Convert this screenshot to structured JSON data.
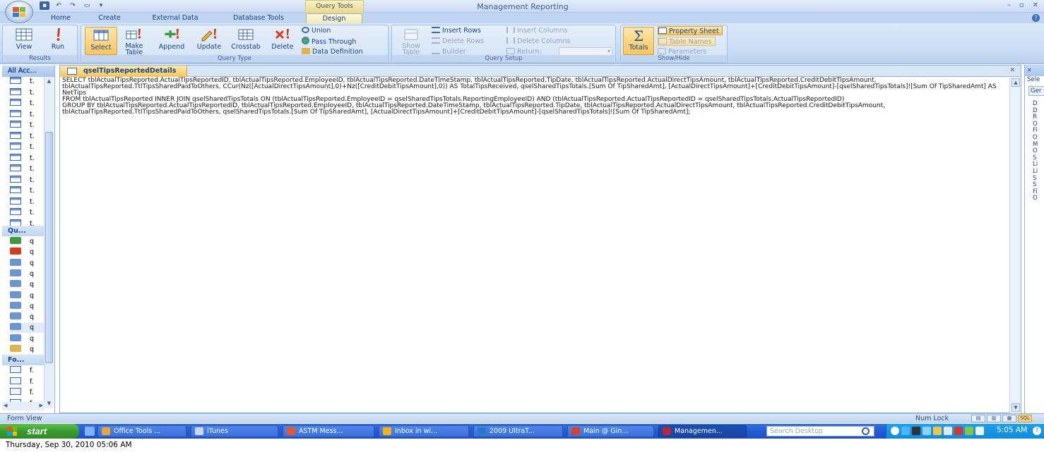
{
  "window": {
    "title": "Management Reporting",
    "contextual_tab_group": "Query Tools",
    "controls": [
      "–",
      "▫",
      "✕"
    ]
  },
  "tabs": [
    {
      "label": "Home"
    },
    {
      "label": "Create"
    },
    {
      "label": "External Data"
    },
    {
      "label": "Database Tools"
    },
    {
      "label": "Design",
      "active": true
    }
  ],
  "ribbon": {
    "results": {
      "label": "Results",
      "view": "View",
      "run": "Run"
    },
    "query_type": {
      "label": "Query Type",
      "select": "Select",
      "make_table": "Make Table",
      "append": "Append",
      "update": "Update",
      "crosstab": "Crosstab",
      "delete": "Delete",
      "union": "Union",
      "pass_through": "Pass Through",
      "data_definition": "Data Definition"
    },
    "query_setup": {
      "label": "Query Setup",
      "show_table": "Show Table",
      "insert_rows": "Insert Rows",
      "delete_rows": "Delete Rows",
      "builder": "Builder",
      "insert_columns": "Insert Columns",
      "delete_columns": "Delete Columns",
      "return": "Return:"
    },
    "show_hide": {
      "label": "Show/Hide",
      "totals": "Totals",
      "property_sheet": "Property Sheet",
      "table_names": "Table Names",
      "parameters": "Parameters"
    }
  },
  "nav_pane": {
    "header": "All Acc...",
    "sections": {
      "queries": "Qu...",
      "forms": "Fo..."
    },
    "table_items": [
      "t.",
      "t.",
      "t.",
      "t.",
      "t.",
      "t.",
      "t.",
      "t.",
      "t.",
      "t.",
      "t.",
      "t.",
      "t.",
      "t."
    ],
    "query_items": [
      "q",
      "q",
      "q",
      "q",
      "q",
      "q",
      "q",
      "q",
      "q",
      "q",
      "q",
      "q"
    ],
    "form_items": [
      "f.",
      "f.",
      "f.",
      "f."
    ]
  },
  "document": {
    "tab_title": "qselTipsReportedDetails",
    "sql": "SELECT tblActualTipsReported.ActualTipsReportedID, tblActualTipsReported.EmployeeID, tblActualTipsReported.DateTimeStamp, tblActualTipsReported.TipDate, tblActualTipsReported.ActualDirectTipsAmount, tblActualTipsReported.CreditDebitTipsAmount, tblActualTipsReported.TtlTipsSharedPaidToOthers, CCur(Nz([ActualDirectTipsAmount],0)+Nz([CreditDebitTipsAmount],0)) AS TotalTipsReceived, qselSharedTipsTotals.[Sum Of TipSharedAmt], [ActualDirectTipsAmount]+[CreditDebitTipsAmount]-[qselSharedTipsTotals]![Sum Of TipSharedAmt] AS NetTips\nFROM tblActualTipsReported INNER JOIN qselSharedTipsTotals ON (tblActualTipsReported.EmployeeID = qselSharedTipsTotals.ReportingEmployeeID) AND (tblActualTipsReported.ActualTipsReportedID = qselSharedTipsTotals.ActualTipsReportedID)\nGROUP BY tblActualTipsReported.ActualTipsReportedID, tblActualTipsReported.EmployeeID, tblActualTipsReported.DateTimeStamp, tblActualTipsReported.TipDate, tblActualTipsReported.ActualDirectTipsAmount, tblActualTipsReported.CreditDebitTipsAmount, tblActualTipsReported.TtlTipsSharedPaidToOthers, qselSharedTipsTotals.[Sum Of TipSharedAmt], [ActualDirectTipsAmount]+[CreditDebitTipsAmount]-[qselSharedTipsTotals]![Sum Of TipSharedAmt];"
  },
  "property_pane": {
    "header": "✕",
    "selection": "Sele",
    "tab": "Ger",
    "letters": [
      "D",
      "D",
      "R",
      "O",
      "Fi",
      "O",
      "M",
      "O",
      "S",
      "Li",
      "Li",
      "S",
      "S",
      "Fi",
      "O"
    ]
  },
  "status_bar": {
    "left": "Form View",
    "right": "Num Lock",
    "view_icons": [
      "▤",
      "▥",
      "▦",
      "SQL"
    ]
  },
  "taskbar": {
    "start": "start",
    "tasks": [
      {
        "label": "Office Tools ...",
        "color": "#e8a33a"
      },
      {
        "label": "iTunes",
        "color": "#c9d7ef"
      },
      {
        "label": "ASTM Mess...",
        "color": "#e2572c"
      },
      {
        "label": "Inbox in wi...",
        "color": "#f2b01e"
      },
      {
        "label": "2009 UltraT...",
        "color": "#2b77c9"
      },
      {
        "label": "Main @ Gin...",
        "color": "#d9402d"
      },
      {
        "label": "Managemen...",
        "color": "#b4273c",
        "active": true
      }
    ],
    "search_placeholder": "Search Desktop",
    "clock": "5:05 AM"
  },
  "datestamp": "Thursday, Sep 30, 2010  05:06 AM"
}
